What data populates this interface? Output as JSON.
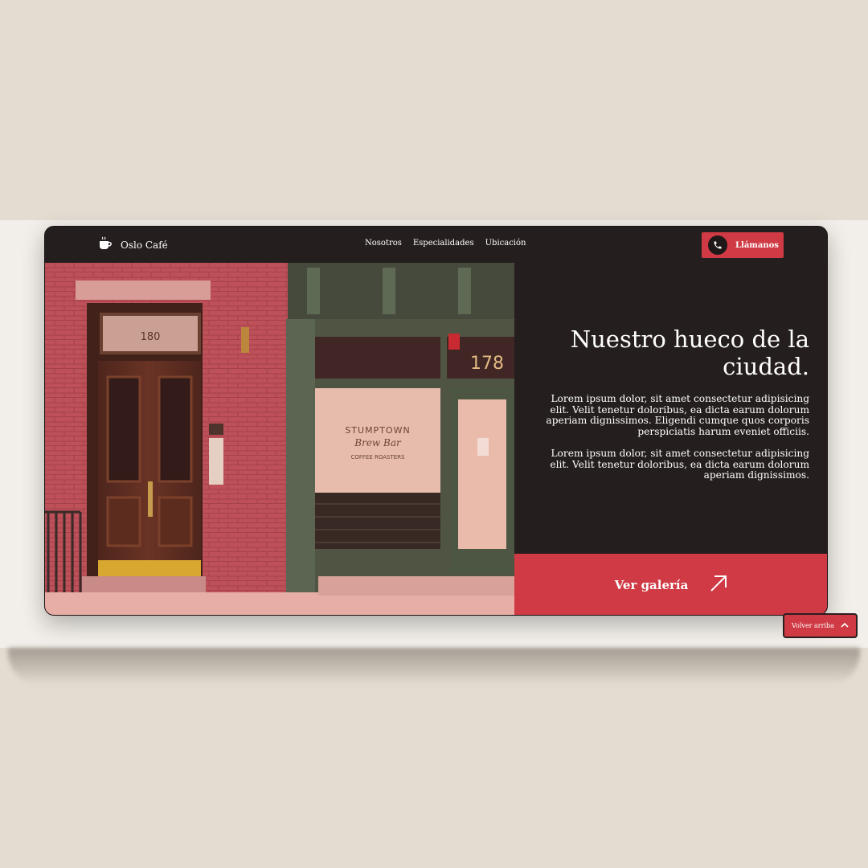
{
  "brand": {
    "name": "Oslo Café",
    "icon": "coffee-cup-icon"
  },
  "nav": {
    "links": [
      "Nosotros",
      "Especialidades",
      "Ubicación"
    ],
    "call_label": "Llámanos"
  },
  "hero": {
    "headline_line1": "Nuestro hueco de la",
    "headline_line2": "ciudad.",
    "paragraph1": "Lorem ipsum dolor, sit amet consectetur adipisicing elit. Velit tenetur doloribus, ea dicta earum dolorum aperiam dignissimos. Eligendi cumque quos corporis perspiciatis harum eveniet officiis.",
    "paragraph2": "Lorem ipsum dolor, sit amet consectetur adipisicing elit. Velit tenetur doloribus, ea dicta earum dolorum aperiam dignissimos.",
    "gallery_label": "Ver galería"
  },
  "photo": {
    "door_number_left": "180",
    "door_number_right": "178",
    "sign_line1": "STUMPTOWN",
    "sign_line2": "Brew Bar",
    "sign_line3": "COFFEE ROASTERS"
  },
  "back_to_top": "Volver arriba",
  "colors": {
    "accent": "#cf3a44",
    "dark": "#251e1e",
    "background": "#e4dcd1",
    "band": "#f2eee9"
  }
}
